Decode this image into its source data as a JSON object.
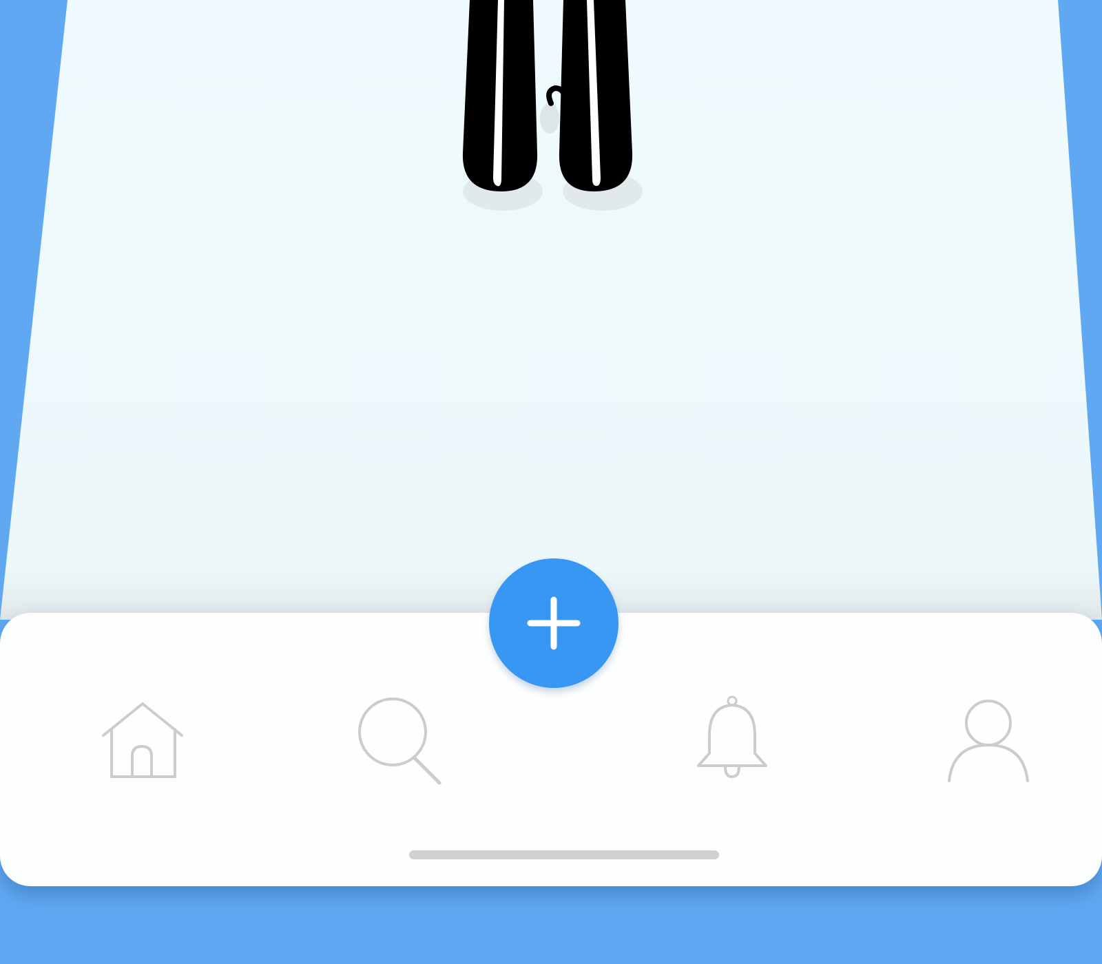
{
  "theme": {
    "background": "#60a9f2",
    "screen": "#eefafd",
    "tabbar": "#fdfefe",
    "accent": "#3897f2",
    "icon_stroke": "#cccccc"
  },
  "content": {
    "illustration": "figure-legs-illustration"
  },
  "fab": {
    "icon": "plus-icon"
  },
  "tabbar": {
    "items": [
      {
        "id": "home",
        "icon": "home-icon"
      },
      {
        "id": "search",
        "icon": "search-icon"
      },
      {
        "id": "notifications",
        "icon": "bell-icon"
      },
      {
        "id": "profile",
        "icon": "user-icon"
      }
    ]
  }
}
